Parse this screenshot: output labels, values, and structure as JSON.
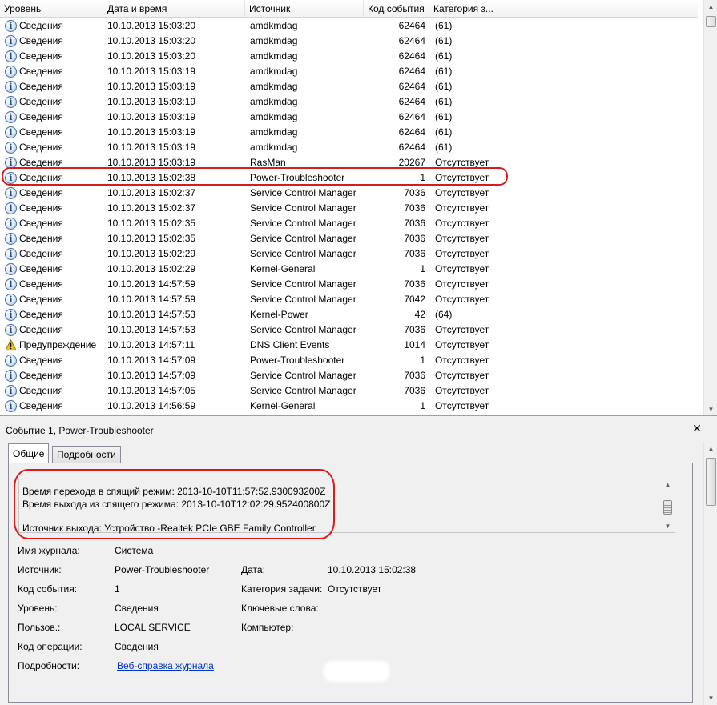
{
  "columns": {
    "level": "Уровень",
    "date": "Дата и время",
    "source": "Источник",
    "event_id": "Код события",
    "category": "Категория з..."
  },
  "rows": [
    {
      "icon": "info-icon",
      "level": "Сведения",
      "date": "10.10.2013 15:03:20",
      "source": "amdkmdag",
      "id": "62464",
      "category": "(61)"
    },
    {
      "icon": "info-icon",
      "level": "Сведения",
      "date": "10.10.2013 15:03:20",
      "source": "amdkmdag",
      "id": "62464",
      "category": "(61)"
    },
    {
      "icon": "info-icon",
      "level": "Сведения",
      "date": "10.10.2013 15:03:20",
      "source": "amdkmdag",
      "id": "62464",
      "category": "(61)"
    },
    {
      "icon": "info-icon",
      "level": "Сведения",
      "date": "10.10.2013 15:03:19",
      "source": "amdkmdag",
      "id": "62464",
      "category": "(61)"
    },
    {
      "icon": "info-icon",
      "level": "Сведения",
      "date": "10.10.2013 15:03:19",
      "source": "amdkmdag",
      "id": "62464",
      "category": "(61)"
    },
    {
      "icon": "info-icon",
      "level": "Сведения",
      "date": "10.10.2013 15:03:19",
      "source": "amdkmdag",
      "id": "62464",
      "category": "(61)"
    },
    {
      "icon": "info-icon",
      "level": "Сведения",
      "date": "10.10.2013 15:03:19",
      "source": "amdkmdag",
      "id": "62464",
      "category": "(61)"
    },
    {
      "icon": "info-icon",
      "level": "Сведения",
      "date": "10.10.2013 15:03:19",
      "source": "amdkmdag",
      "id": "62464",
      "category": "(61)"
    },
    {
      "icon": "info-icon",
      "level": "Сведения",
      "date": "10.10.2013 15:03:19",
      "source": "amdkmdag",
      "id": "62464",
      "category": "(61)"
    },
    {
      "icon": "info-icon",
      "level": "Сведения",
      "date": "10.10.2013 15:03:19",
      "source": "RasMan",
      "id": "20267",
      "category": "Отсутствует"
    },
    {
      "icon": "info-icon",
      "level": "Сведения",
      "date": "10.10.2013 15:02:38",
      "source": "Power-Troubleshooter",
      "id": "1",
      "category": "Отсутствует"
    },
    {
      "icon": "info-icon",
      "level": "Сведения",
      "date": "10.10.2013 15:02:37",
      "source": "Service Control Manager",
      "id": "7036",
      "category": "Отсутствует"
    },
    {
      "icon": "info-icon",
      "level": "Сведения",
      "date": "10.10.2013 15:02:37",
      "source": "Service Control Manager",
      "id": "7036",
      "category": "Отсутствует"
    },
    {
      "icon": "info-icon",
      "level": "Сведения",
      "date": "10.10.2013 15:02:35",
      "source": "Service Control Manager",
      "id": "7036",
      "category": "Отсутствует"
    },
    {
      "icon": "info-icon",
      "level": "Сведения",
      "date": "10.10.2013 15:02:35",
      "source": "Service Control Manager",
      "id": "7036",
      "category": "Отсутствует"
    },
    {
      "icon": "info-icon",
      "level": "Сведения",
      "date": "10.10.2013 15:02:29",
      "source": "Service Control Manager",
      "id": "7036",
      "category": "Отсутствует"
    },
    {
      "icon": "info-icon",
      "level": "Сведения",
      "date": "10.10.2013 15:02:29",
      "source": "Kernel-General",
      "id": "1",
      "category": "Отсутствует"
    },
    {
      "icon": "info-icon",
      "level": "Сведения",
      "date": "10.10.2013 14:57:59",
      "source": "Service Control Manager",
      "id": "7036",
      "category": "Отсутствует"
    },
    {
      "icon": "info-icon",
      "level": "Сведения",
      "date": "10.10.2013 14:57:59",
      "source": "Service Control Manager",
      "id": "7042",
      "category": "Отсутствует"
    },
    {
      "icon": "info-icon",
      "level": "Сведения",
      "date": "10.10.2013 14:57:53",
      "source": "Kernel-Power",
      "id": "42",
      "category": "(64)"
    },
    {
      "icon": "info-icon",
      "level": "Сведения",
      "date": "10.10.2013 14:57:53",
      "source": "Service Control Manager",
      "id": "7036",
      "category": "Отсутствует"
    },
    {
      "icon": "warning-icon",
      "level": "Предупреждение",
      "date": "10.10.2013 14:57:11",
      "source": "DNS Client Events",
      "id": "1014",
      "category": "Отсутствует"
    },
    {
      "icon": "info-icon",
      "level": "Сведения",
      "date": "10.10.2013 14:57:09",
      "source": "Power-Troubleshooter",
      "id": "1",
      "category": "Отсутствует"
    },
    {
      "icon": "info-icon",
      "level": "Сведения",
      "date": "10.10.2013 14:57:09",
      "source": "Service Control Manager",
      "id": "7036",
      "category": "Отсутствует"
    },
    {
      "icon": "info-icon",
      "level": "Сведения",
      "date": "10.10.2013 14:57:05",
      "source": "Service Control Manager",
      "id": "7036",
      "category": "Отсутствует"
    },
    {
      "icon": "info-icon",
      "level": "Сведения",
      "date": "10.10.2013 14:56:59",
      "source": "Kernel-General",
      "id": "1",
      "category": "Отсутствует"
    }
  ],
  "detail": {
    "title": "Событие 1, Power-Troubleshooter",
    "close_glyph": "✕",
    "tabs": [
      "Общие",
      "Подробности"
    ],
    "message_lines": [
      "Время перехода в спящий режим: 2013-10-10T11:57:52.930093200Z",
      "Время выхода из спящего режима: 2013-10-10T12:02:29.952400800Z",
      "",
      "Источник выхода: Устройство -Realtek PCIe GBE Family Controller"
    ],
    "props": {
      "journal_label": "Имя журнала:",
      "journal_value": "Система",
      "source_label": "Источник:",
      "source_value": "Power-Troubleshooter",
      "date_label": "Дата:",
      "date_value": "10.10.2013 15:02:38",
      "event_label": "Код события:",
      "event_value": "1",
      "task_label": "Категория задачи:",
      "task_value": "Отсутствует",
      "level_label": "Уровень:",
      "level_value": "Сведения",
      "keywords_label": "Ключевые слова:",
      "user_label": "Пользов.:",
      "user_value": "LOCAL SERVICE",
      "computer_label": "Компьютер:",
      "opcode_label": "Код операции:",
      "opcode_value": "Сведения",
      "details_label": "Подробности:",
      "details_link": "Веб-справка журнала"
    }
  },
  "colors": {
    "annotation": "#d81c1c",
    "link": "#0033cc",
    "info_icon": "#1c4a8e",
    "warning_icon": "#f2c200"
  }
}
